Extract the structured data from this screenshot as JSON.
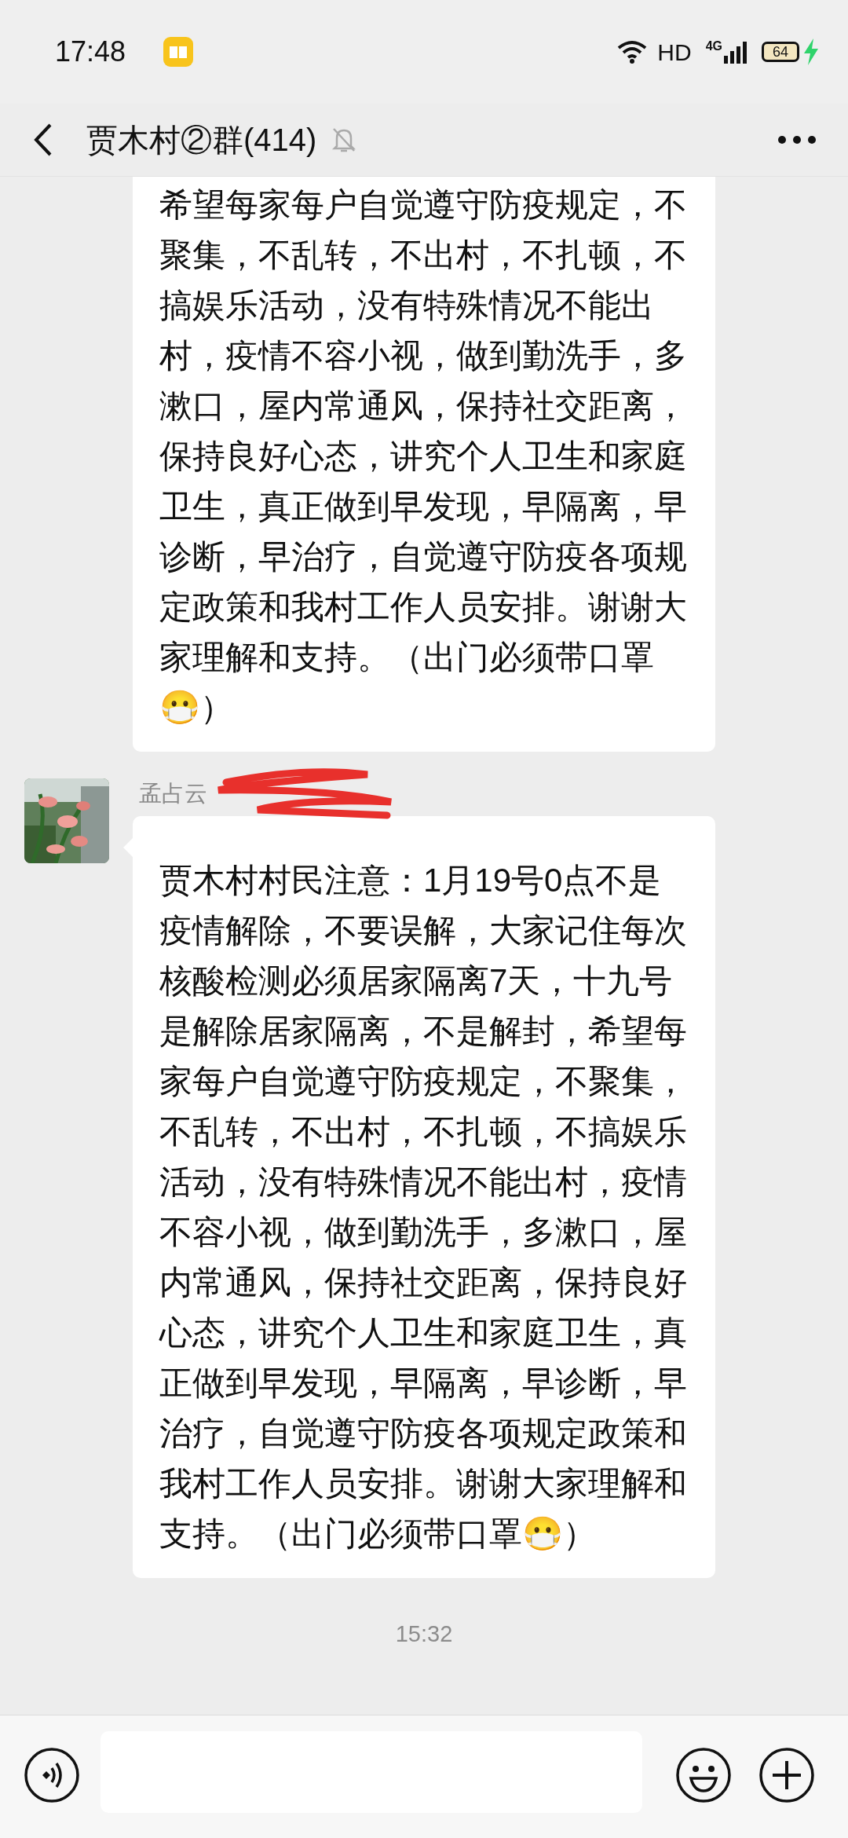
{
  "status_bar": {
    "time": "17:48",
    "hd": "HD",
    "network": "4G",
    "battery": "64",
    "charging": true
  },
  "header": {
    "title": "贾木村②群(414)",
    "muted": true
  },
  "messages": [
    {
      "text": "希望每家每户自觉遵守防疫规定，不聚集，不乱转，不出村，不扎顿，不搞娱乐活动，没有特殊情况不能出村，疫情不容小视，做到勤洗手，多漱口，屋内常通风，保持社交距离，保持良好心态，讲究个人卫生和家庭卫生，真正做到早发现，早隔离，早诊断，早治疗，自觉遵守防疫各项规定政策和我村工作人员安排。谢谢大家理解和支持。（出门必须带口罩😷）"
    },
    {
      "sender": "孟占云",
      "text": "贾木村村民注意：1月19号0点不是疫情解除，不要误解，大家记住每次核酸检测必须居家隔离7天，十九号是解除居家隔离，不是解封，希望每家每户自觉遵守防疫规定，不聚集，不乱转，不出村，不扎顿，不搞娱乐活动，没有特殊情况不能出村，疫情不容小视，做到勤洗手，多漱口，屋内常通风，保持社交距离，保持良好心态，讲究个人卫生和家庭卫生，真正做到早发现，早隔离，早诊断，早治疗，自觉遵守防疫各项规定政策和我村工作人员安排。谢谢大家理解和支持。（出门必须带口罩😷）"
    }
  ],
  "timestamp": "15:32"
}
